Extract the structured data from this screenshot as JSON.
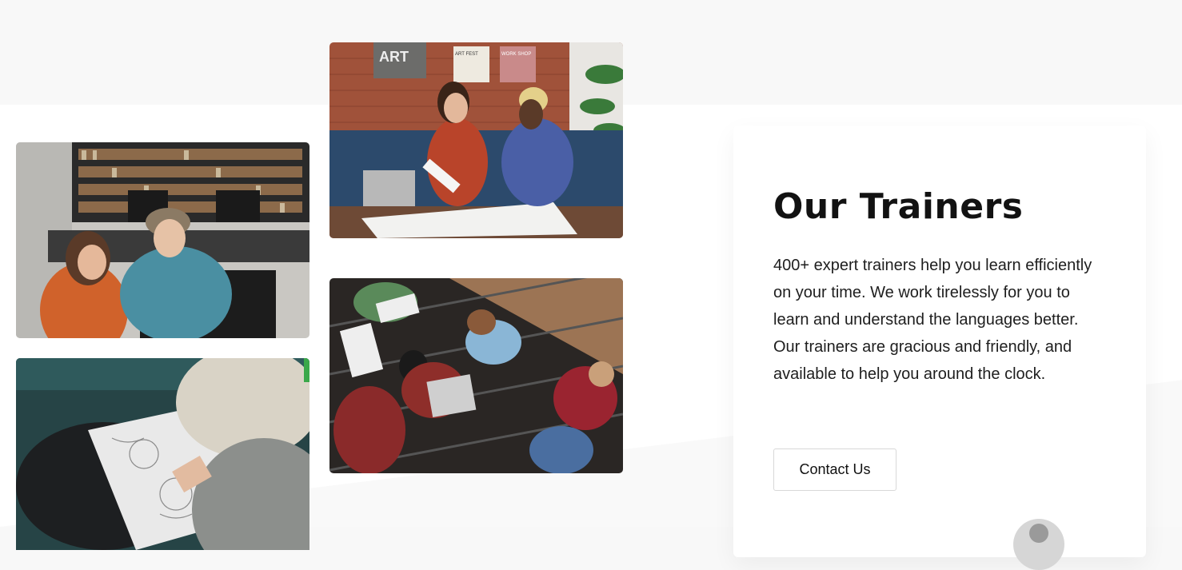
{
  "trainers": {
    "title": "Our Trainers",
    "description": "400+ expert trainers help you learn efficiently on your time. We work tirelessly for you to learn and understand the languages better. Our trainers are gracious and friendly, and available to help you around the clock.",
    "contact_label": "Contact Us"
  },
  "meeting_photo": {
    "posters": [
      "ART",
      "ART FEST",
      "WORK SHOP"
    ]
  },
  "colors": {
    "background_light": "#f8f8f8",
    "card": "#ffffff",
    "heading": "#121212",
    "button_border": "#d8d8d8"
  }
}
